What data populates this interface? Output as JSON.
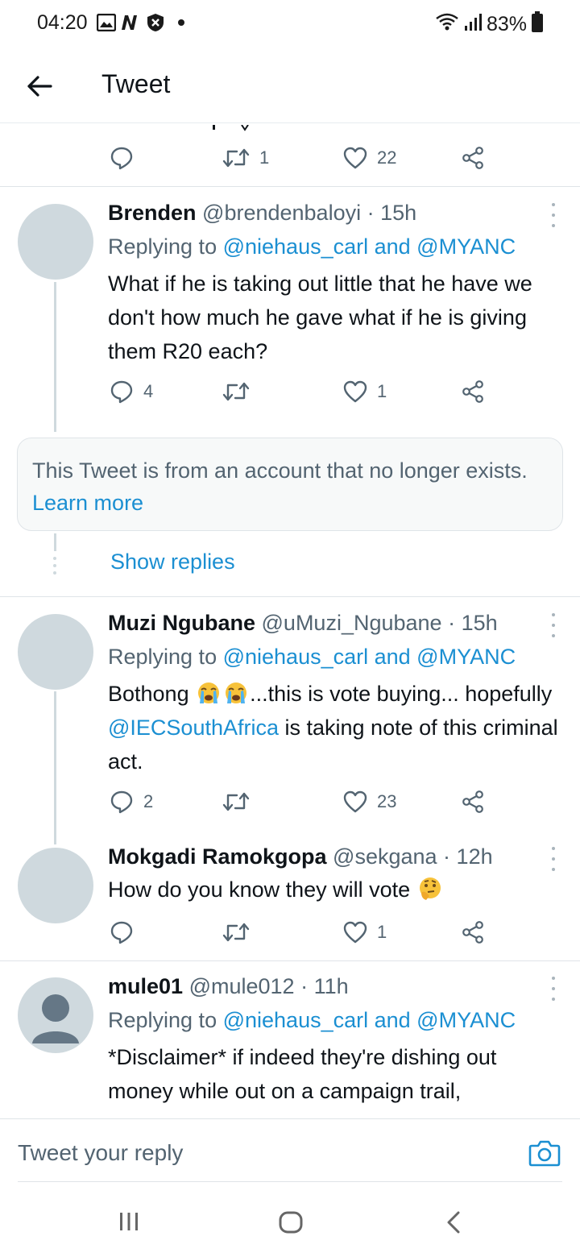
{
  "status_bar": {
    "time": "04:20",
    "battery": "83%"
  },
  "header": {
    "title": "Tweet"
  },
  "top_actions": {
    "retweets": "1",
    "likes": "22"
  },
  "tweets": [
    {
      "name": "Brenden",
      "handle": "@brendenbaloyi",
      "time": "15h",
      "replying_prefix": "Replying to ",
      "replying_user1": "@niehaus_carl",
      "replying_and": " and ",
      "replying_user2": "@MYANC",
      "body": "What if he is taking out little that he have we don't how much he gave what if he is giving them R20 each?",
      "replies": "4",
      "retweets": "",
      "likes": "1"
    },
    {
      "name": "Muzi Ngubane",
      "handle": "@uMuzi_Ngubane",
      "time": "15h",
      "replying_prefix": "Replying to ",
      "replying_user1": "@niehaus_carl",
      "replying_and": " and ",
      "replying_user2": "@MYANC",
      "body_part1": "Bothong ",
      "body_part2": "...this is vote buying... hopefully ",
      "body_mention": "@IECSouthAfrica",
      "body_part3": " is taking note of this criminal act.",
      "replies": "2",
      "retweets": "",
      "likes": "23"
    },
    {
      "name": "Mokgadi Ramokgopa",
      "handle": "@sekgana",
      "time": "12h",
      "body": "How do you know they will vote ",
      "replies": "",
      "retweets": "",
      "likes": "1"
    },
    {
      "name": "mule01",
      "handle": "@mule012",
      "time": "11h",
      "replying_prefix": "Replying to ",
      "replying_user1": "@niehaus_carl",
      "replying_and": " and ",
      "replying_user2": "@MYANC",
      "body": "*Disclaimer* if indeed they're dishing out money while out on a campaign trail,"
    }
  ],
  "notice": {
    "text": "This Tweet is from an account that no longer exists. ",
    "link": "Learn more"
  },
  "show_replies": "Show replies",
  "separator": " · ",
  "reply_bar": {
    "placeholder": "Tweet your reply"
  },
  "icons": {
    "back": "arrow-left-icon",
    "reply": "comment-icon",
    "retweet": "retweet-icon",
    "like": "heart-icon",
    "share": "share-icon",
    "camera": "camera-icon"
  },
  "colors": {
    "link": "#1b8fd2",
    "muted": "#536471",
    "avatar": "#cfd9de"
  }
}
